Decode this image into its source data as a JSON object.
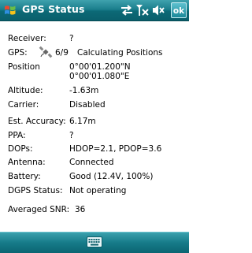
{
  "window": {
    "title": "GPS Status",
    "ok_label": "ok"
  },
  "status_icons": [
    "sync-icon",
    "signal-off-icon",
    "volume-muted-icon"
  ],
  "rows": {
    "receiver": {
      "label": "Receiver:",
      "value": "?"
    },
    "gps": {
      "label": "GPS:",
      "satellites": "6/9",
      "value": "Calculating Positions"
    },
    "position": {
      "label": "Position",
      "lat": "0°00'01.200\"N",
      "lon": "0°00'01.080\"E"
    },
    "altitude": {
      "label": "Altitude:",
      "value": "-1.63m"
    },
    "carrier": {
      "label": "Carrier:",
      "value": "Disabled"
    },
    "accuracy": {
      "label": "Est. Accuracy:",
      "value": "6.17m"
    },
    "ppa": {
      "label": "PPA:",
      "value": "?"
    },
    "dops": {
      "label": "DOPs:",
      "value": "HDOP=2.1, PDOP=3.6"
    },
    "antenna": {
      "label": "Antenna:",
      "value": "Connected"
    },
    "battery": {
      "label": "Battery:",
      "value": "Good (12.4V, 100%)"
    },
    "dgps": {
      "label": "DGPS Status:",
      "value": "Not operating"
    },
    "snr": {
      "label": "Averaged SNR:",
      "value": "36"
    }
  },
  "colors": {
    "titlebar": "#1b7f8d",
    "text": "#000000",
    "background": "#ffffff"
  }
}
